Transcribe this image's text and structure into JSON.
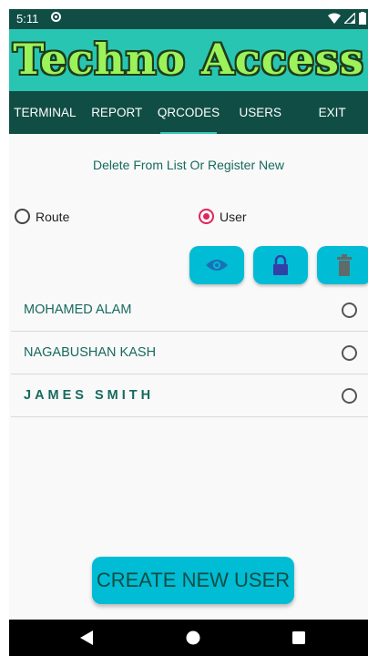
{
  "status_bar": {
    "time": "5:11"
  },
  "app": {
    "title": "Techno Access"
  },
  "tabs": [
    {
      "label": "TERMINAL"
    },
    {
      "label": "REPORT"
    },
    {
      "label": "QRCODES",
      "active": true
    },
    {
      "label": "USERS"
    },
    {
      "label": "EXIT"
    }
  ],
  "content": {
    "subtitle": "Delete From List Or Register New",
    "radio_route": {
      "label": "Route",
      "checked": false
    },
    "radio_user": {
      "label": "User",
      "checked": true
    },
    "action_buttons": [
      "eye-icon",
      "lock-icon",
      "trash-icon"
    ],
    "users": [
      {
        "name": "MOHAMED ALAM"
      },
      {
        "name": "NAGABUSHAN KASH"
      },
      {
        "name": "JAMES SMITH"
      }
    ],
    "create_button": "CREATE NEW USER"
  },
  "colors": {
    "header_dark": "#104e45",
    "banner": "#29c5b3",
    "accent_button": "#00bcd4",
    "radio_selected": "#e0245e",
    "list_text": "#176a5e"
  }
}
